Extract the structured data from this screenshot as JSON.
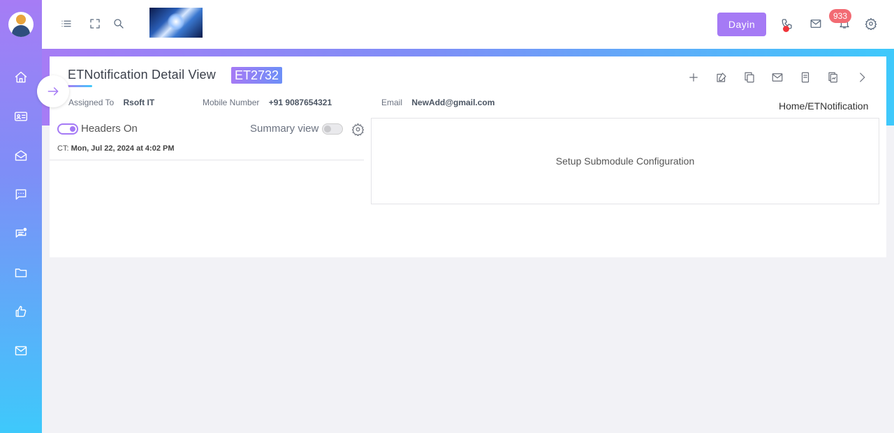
{
  "sidebar": {
    "avatar": "user-avatar",
    "items": [
      {
        "name": "home-icon"
      },
      {
        "name": "id-card-icon"
      },
      {
        "name": "mail-open-icon"
      },
      {
        "name": "chat-icon"
      },
      {
        "name": "message-notification-icon"
      },
      {
        "name": "folder-icon"
      },
      {
        "name": "thumbs-up-icon"
      },
      {
        "name": "mail-icon"
      }
    ]
  },
  "topbar": {
    "dayin_label": "Dayin",
    "notification_count": "933"
  },
  "page": {
    "title": "ETNotification Detail View",
    "record_id": "ET2732",
    "breadcrumb": "Home/ETNotification"
  },
  "meta": {
    "assigned_to_label": "Assigned To",
    "assigned_to_value": "Rsoft  IT",
    "mobile_label": "Mobile Number",
    "mobile_value": "+91 9087654321",
    "email_label": "Email",
    "email_value": "NewAdd@gmail.com"
  },
  "controls": {
    "headers_label": "Headers On",
    "headers_on": true,
    "summary_label": "Summary view",
    "summary_on": false
  },
  "created": {
    "label": "CT:",
    "value": "Mon, Jul 22, 2024 at 4:02 PM"
  },
  "submodule": {
    "message": "Setup Submodule Configuration"
  },
  "colors": {
    "accent": "#a57af5",
    "gradient_end": "#3ec9fb",
    "badge": "#f26b73",
    "dot": "#f0353b"
  }
}
